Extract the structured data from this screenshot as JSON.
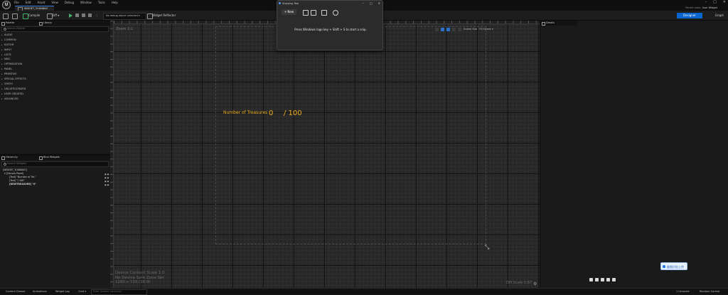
{
  "menu": [
    "File",
    "Edit",
    "Asset",
    "View",
    "Debug",
    "Window",
    "Tools",
    "Help"
  ],
  "doc_tab": "WIDGET_YUANBAO",
  "parent_class": {
    "label": "Parent class:",
    "value": "User Widget"
  },
  "toolbar": {
    "compile": "Compile",
    "diff": "Diff ▾",
    "debug_filter": "No debug object selected ▾",
    "widget_reflector": "Widget Reflector",
    "designer": "Designer",
    "graph": "Graph"
  },
  "palette": {
    "tab_palette": "Palette",
    "tab_library": "Library",
    "search_placeholder": "Search Palette",
    "categories": [
      "AUDIO",
      "COMMON",
      "EDITOR",
      "INPUT",
      "LISTS",
      "MISC",
      "OPTIMIZATION",
      "PANEL",
      "PRIMITIVE",
      "SPECIAL EFFECTS",
      "SYNTH",
      "UNCATEGORIZED",
      "USER CREATED",
      "ADVANCED"
    ]
  },
  "hierarchy": {
    "tab_hierarchy": "Hierarchy",
    "tab_bind": "Bind Widgets",
    "search_placeholder": "Search Widgets",
    "items": [
      "[WIDGET_YUANBAO]",
      "▾ [Canvas Panel]",
      "[Text] \"Number of Tre.\"",
      "[Text] \"/ 100\"",
      "[NEWTREASURE] \"0\""
    ]
  },
  "viewport": {
    "zoom": "Zoom 1:1",
    "tools": [
      "Screen Size",
      "Fill Screen ▾"
    ],
    "device_info": [
      "Device Content Scale 1.0",
      "No Device Safe Zone Set",
      "1280 x 720 (16:9)"
    ],
    "dpi": "DPI Scale 0.67"
  },
  "game_text": {
    "label": "Number of Treasures",
    "count": "0",
    "total": "/ 100"
  },
  "details": {
    "tab": "Details"
  },
  "snipping_tool": {
    "title": "Snipping Tool",
    "new_button": "+ New",
    "message": "Press Windows logo key + Shift + S to start a snip."
  },
  "floating_button": "截图识别上传",
  "status_bar": {
    "content_drawer": "Content Drawer",
    "animations": "Animations",
    "widget_log": "Widget Log",
    "cmd": "Cmd ▾",
    "cmd_placeholder": "Enter Console Command",
    "unsaved": "1 Unsaved",
    "revision": "Revision Control"
  }
}
